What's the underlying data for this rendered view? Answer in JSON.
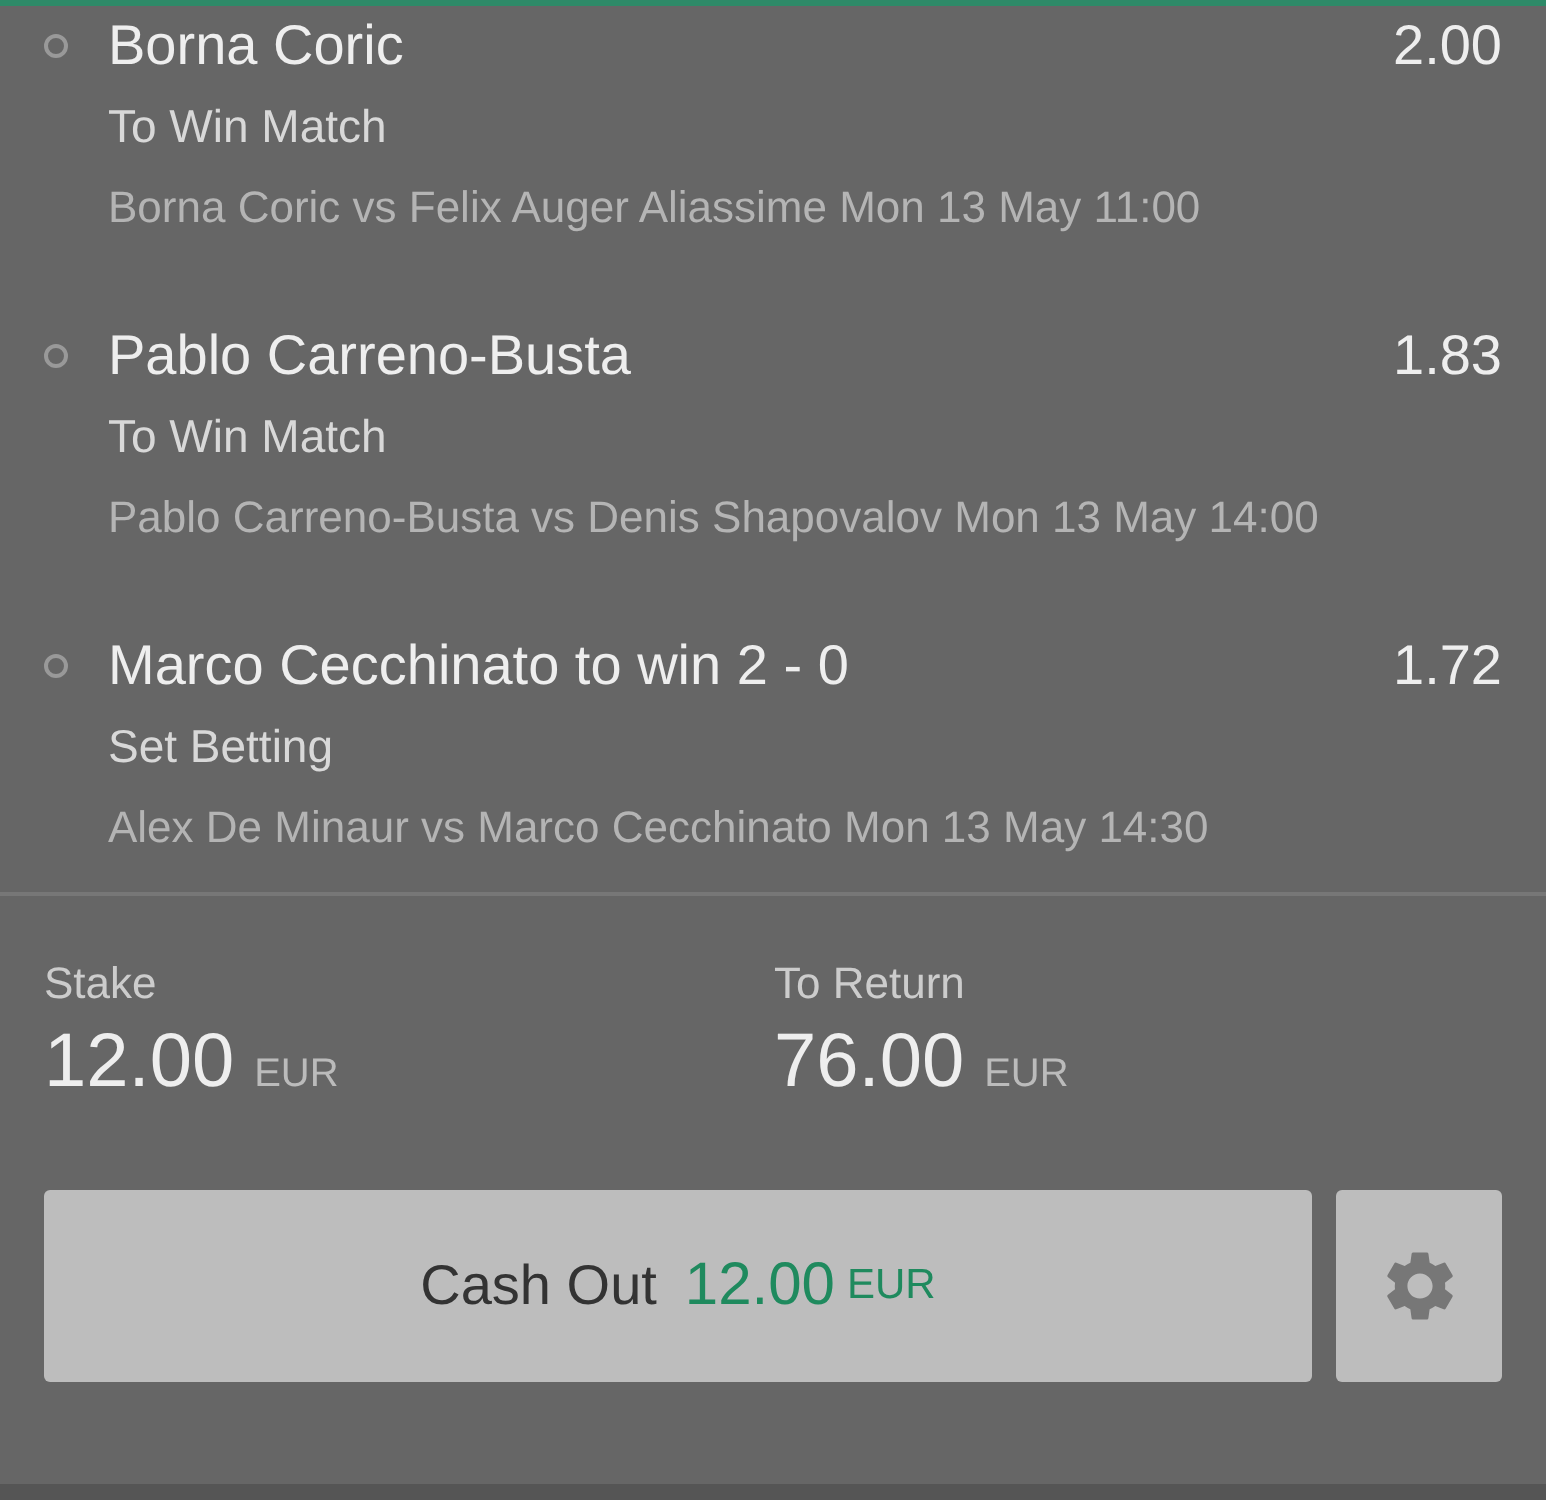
{
  "selections": [
    {
      "name": "Borna Coric",
      "odds": "2.00",
      "market": "To Win Match",
      "event": "Borna Coric vs Felix Auger Aliassime Mon 13 May 11:00"
    },
    {
      "name": "Pablo Carreno-Busta",
      "odds": "1.83",
      "market": "To Win Match",
      "event": "Pablo Carreno-Busta vs Denis Shapovalov Mon 13 May 14:00"
    },
    {
      "name": "Marco Cecchinato to win 2 - 0",
      "odds": "1.72",
      "market": "Set Betting",
      "event": "Alex De Minaur vs Marco Cecchinato Mon 13 May 14:30"
    }
  ],
  "stake": {
    "label": "Stake",
    "amount": "12.00",
    "currency": "EUR"
  },
  "to_return": {
    "label": "To Return",
    "amount": "76.00",
    "currency": "EUR"
  },
  "cash_out": {
    "label": "Cash Out",
    "amount": "12.00",
    "currency": "EUR"
  }
}
